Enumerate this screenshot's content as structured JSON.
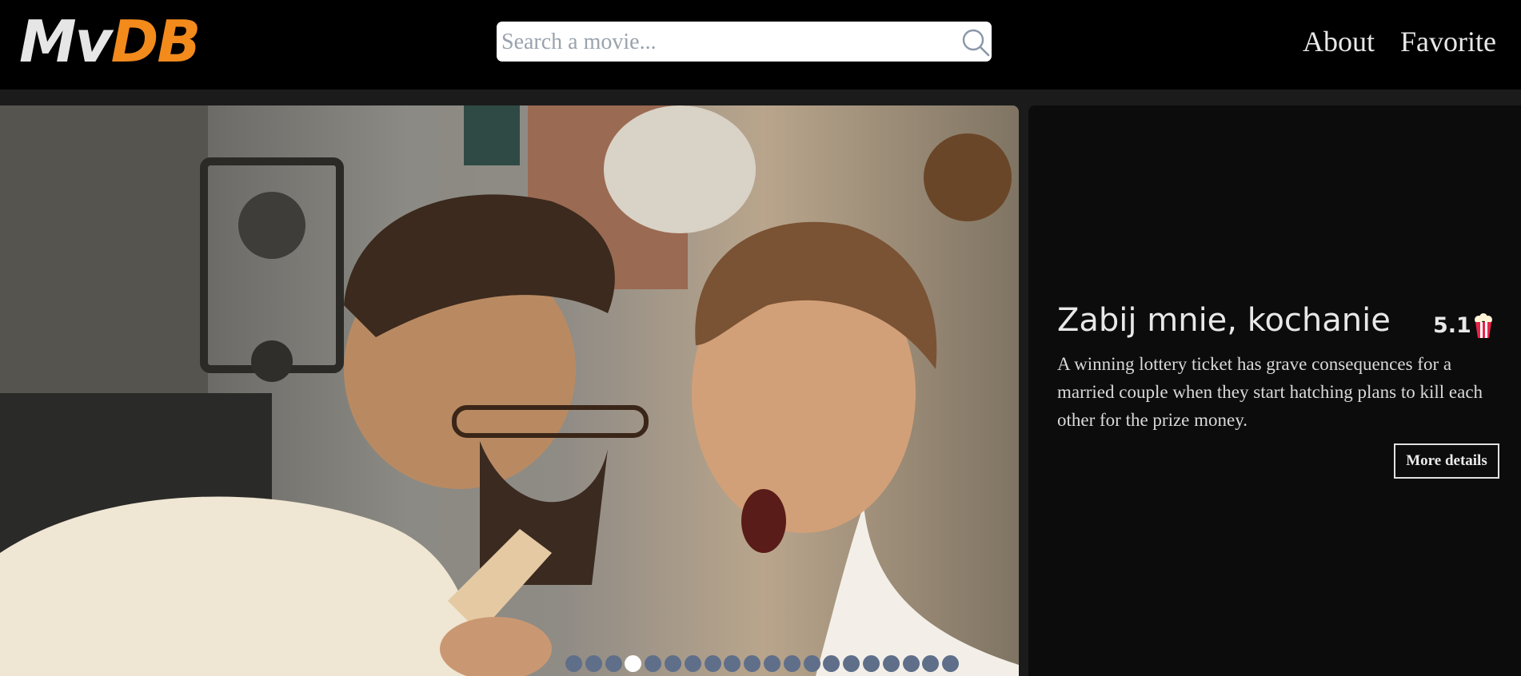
{
  "brand": {
    "logo_mv": "Mv",
    "logo_db": "DB",
    "accent": "#f28a1c"
  },
  "search": {
    "placeholder": "Search a movie...",
    "value": ""
  },
  "nav": {
    "about": "About",
    "favorite": "Favorite"
  },
  "featured": {
    "title": "Zabij mnie, kochanie",
    "rating": "5.1",
    "overview": "A winning lottery ticket has grave consequences for a married couple when they start hatching plans to kill each other for the prize money.",
    "more_label": "More details"
  },
  "carousel": {
    "slides": 20,
    "active_index": 3
  }
}
